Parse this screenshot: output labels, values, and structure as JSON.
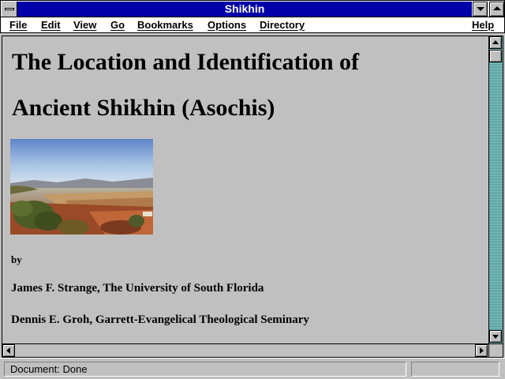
{
  "window": {
    "title": "Shikhin"
  },
  "menu": {
    "items": [
      {
        "label": "File"
      },
      {
        "label": "Edit"
      },
      {
        "label": "View"
      },
      {
        "label": "Go"
      },
      {
        "label": "Bookmarks"
      },
      {
        "label": "Options"
      },
      {
        "label": "Directory"
      },
      {
        "label": "Help"
      }
    ]
  },
  "page": {
    "heading_line1": "The Location and Identification of",
    "heading_line2": "Ancient Shikhin (Asochis)",
    "by_label": "by",
    "author1": "James F. Strange, The University of South Florida",
    "author2": "Dennis E. Groh, Garrett-Evangelical Theological Seminary",
    "photo_icon": "landscape-photo"
  },
  "status": {
    "text": "Document: Done"
  },
  "colors": {
    "titlebar": "#0000a8",
    "background": "#c0c0c0",
    "scroll_track": "#5fa5a5"
  }
}
